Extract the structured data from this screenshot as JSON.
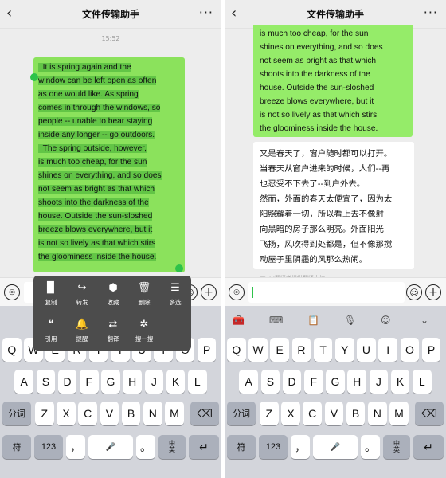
{
  "title": "文件传输助手",
  "more": "···",
  "back": "‹",
  "time": "15:52",
  "left": {
    "bubble_lines": [
      "  It is spring again and the",
      "window can be left open as often",
      "as one would like. As spring",
      "comes in through the windows, so",
      "people -- unable to bear staying",
      "inside any longer -- go outdoors.",
      "  The spring outside, however,",
      "is much too cheap, for the sun",
      "shines on everything, and so does",
      "not seem as bright as that which",
      "shoots into the darkness of the",
      "house. Outside the sun-sloshed",
      "breeze blows everywhere, but it",
      "is not so lively as that which stirs",
      "the gloominess inside the house."
    ],
    "menu": [
      {
        "label": "复制",
        "icon": "▉"
      },
      {
        "label": "转发",
        "icon": "↪"
      },
      {
        "label": "收藏",
        "icon": "⬢"
      },
      {
        "label": "删除",
        "icon": "🗑"
      },
      {
        "label": "多选",
        "icon": "☰"
      },
      {
        "label": "引用",
        "icon": "❝"
      },
      {
        "label": "提醒",
        "icon": "🔔"
      },
      {
        "label": "翻译",
        "icon": "⇄"
      },
      {
        "label": "搜一搜",
        "icon": "✲"
      }
    ]
  },
  "right": {
    "bubble_lines": [
      "is much too cheap, for the sun",
      "shines on everything, and so does",
      "not seem as bright as that which",
      "shoots into the darkness of the",
      "house. Outside the sun-sloshed",
      "breeze blows everywhere, but it",
      "is not so lively as that which stirs",
      "the gloominess inside the house."
    ],
    "translation_lines": [
      "又是春天了，窗户随时都可以打开。",
      "当春天从窗户进来的时候，人们--再",
      "也忍受不下去了--到户外去。",
      "然而，外面的春天太便宜了，因为太",
      "阳照耀着一切，所以看上去不像射",
      "向黑暗的房子那么明亮。外面阳光",
      "飞扬，风吹得到处都是，但不像那搅",
      "动屋子里阴霾的风那么热闹。"
    ],
    "translation_footer": "由翻译者提供翻译支持"
  },
  "keyboard": {
    "row1": [
      "Q",
      "W",
      "E",
      "R",
      "T",
      "Y",
      "U",
      "I",
      "O",
      "P"
    ],
    "row2": [
      "A",
      "S",
      "D",
      "F",
      "G",
      "H",
      "J",
      "K",
      "L"
    ],
    "row3": [
      "Z",
      "X",
      "C",
      "V",
      "B",
      "N",
      "M"
    ],
    "fenci": "分词",
    "fu": "符",
    "num": "123",
    "comma": "，",
    "period": "。",
    "zh": "中",
    "en": "英",
    "enter": "↵",
    "backspace": "⌫"
  },
  "icons": {
    "voice": "◎",
    "emoji": "☺",
    "plus": "+",
    "mic": "🎤",
    "collapse": "⌄"
  },
  "colors": {
    "bubble": "#95ec69",
    "selection": "#62c546",
    "accent": "#2ec24a"
  }
}
